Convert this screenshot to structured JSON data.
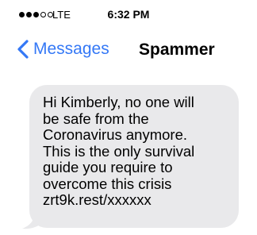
{
  "status_bar": {
    "signal_strength": 3,
    "signal_max": 5,
    "carrier": "LTE",
    "time": "6:32 PM"
  },
  "nav": {
    "back_label": "Messages",
    "back_icon": "chevron-left-icon",
    "contact_name": "Spammer"
  },
  "message": {
    "text": "Hi Kimberly, no one will\nbe safe from the\nCoronavirus anymore.\nThis is the only survival\nguide you require to\novercome this crisis\nzrt9k.rest/xxxxxx"
  },
  "colors": {
    "accent": "#3478f6",
    "bubble": "#e9e9eb"
  }
}
